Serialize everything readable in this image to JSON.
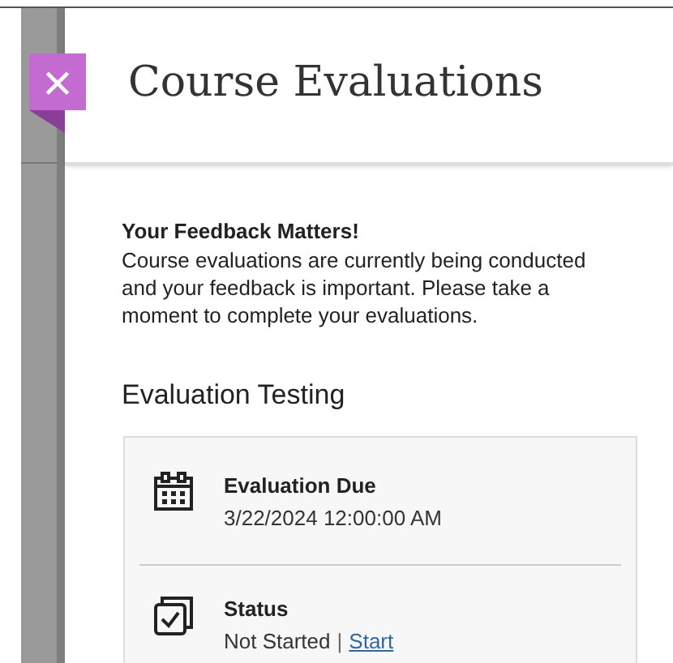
{
  "panel": {
    "title": "Course Evaluations",
    "close_icon": "×"
  },
  "intro": {
    "heading": "Your Feedback Matters!",
    "text": "Course evaluations are currently being conducted and your feedback is important. Please take a moment to complete your evaluations."
  },
  "evaluation": {
    "title": "Evaluation Testing",
    "items": [
      {
        "kind": "due",
        "label": "Evaluation Due",
        "value": "3/22/2024 12:00:00 AM"
      },
      {
        "kind": "status",
        "label": "Status",
        "value": "Not Started",
        "separator": "|",
        "link": "Start"
      }
    ]
  }
}
